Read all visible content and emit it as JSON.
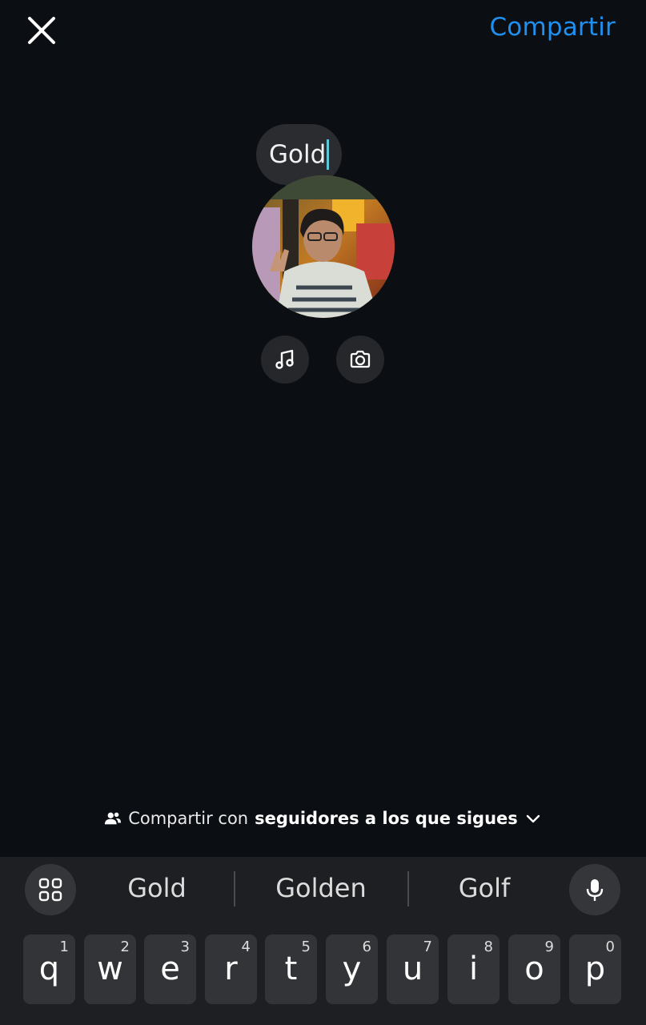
{
  "header": {
    "close_icon": "close-icon",
    "share_label": "Compartir"
  },
  "note": {
    "text": "Gold"
  },
  "actions": {
    "music_icon": "music-note-icon",
    "camera_icon": "camera-icon"
  },
  "audience": {
    "icon": "people-icon",
    "prefix": "Compartir con",
    "selection": "seguidores a los que sigues",
    "chevron": "chevron-down-icon"
  },
  "keyboard": {
    "suggestions": [
      "Gold",
      "Golden",
      "Golf"
    ],
    "keys": [
      {
        "letter": "q",
        "hint": "1"
      },
      {
        "letter": "w",
        "hint": "2"
      },
      {
        "letter": "e",
        "hint": "3"
      },
      {
        "letter": "r",
        "hint": "4"
      },
      {
        "letter": "t",
        "hint": "5"
      },
      {
        "letter": "y",
        "hint": "6"
      },
      {
        "letter": "u",
        "hint": "7"
      },
      {
        "letter": "i",
        "hint": "8"
      },
      {
        "letter": "o",
        "hint": "9"
      },
      {
        "letter": "p",
        "hint": "0"
      }
    ]
  },
  "colors": {
    "background": "#0b0e13",
    "accent": "#1f8ff0",
    "caret": "#5fc6d8"
  }
}
